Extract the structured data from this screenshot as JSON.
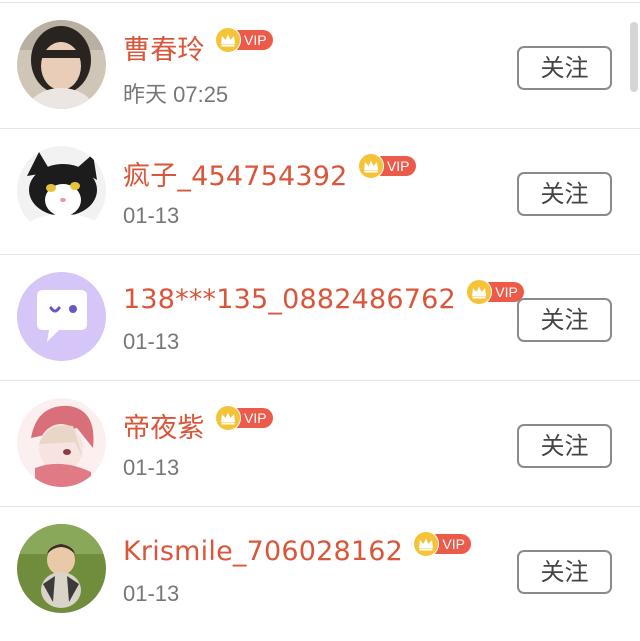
{
  "follow_list": {
    "items": [
      {
        "name": "曹春玲",
        "time": "昨天 07:25",
        "vip": "VIP",
        "follow_label": "关注",
        "avatar": "photo-woman-avatar"
      },
      {
        "name": "疯子_454754392",
        "time": "01-13",
        "vip": "VIP",
        "follow_label": "关注",
        "avatar": "black-white-cat-avatar"
      },
      {
        "name": "138***135_0882486762",
        "time": "01-13",
        "vip": "VIP",
        "follow_label": "关注",
        "avatar": "purple-chat-bubble-avatar"
      },
      {
        "name": "帝夜紫",
        "time": "01-13",
        "vip": "VIP",
        "follow_label": "关注",
        "avatar": "anime-girl-avatar"
      },
      {
        "name": "Krismile_706028162",
        "time": "01-13",
        "vip": "VIP",
        "follow_label": "关注",
        "avatar": "baby-photo-avatar"
      }
    ]
  },
  "colors": {
    "name_text": "#d9563a",
    "vip_pill": "#ec5a49",
    "crown": "#f5c338",
    "time_text": "#777777",
    "button_border": "#8a8a8a"
  }
}
